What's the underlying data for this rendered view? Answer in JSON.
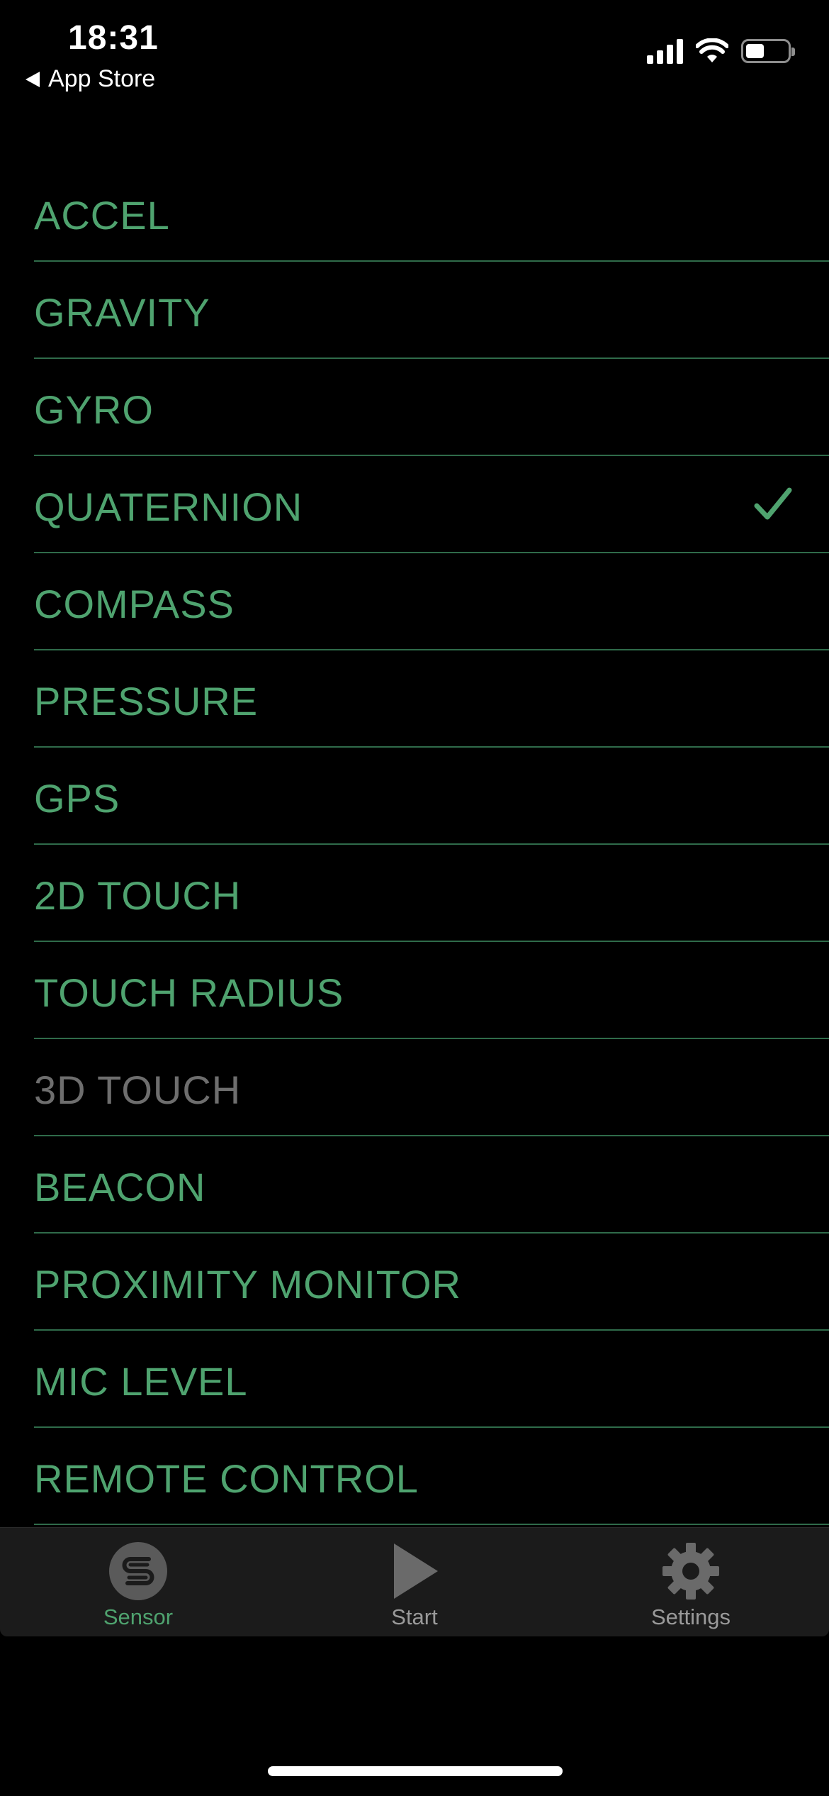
{
  "status_bar": {
    "time": "18:31",
    "back_label": "App Store",
    "battery_level": 0.45
  },
  "sensors": [
    {
      "label": "ACCEL",
      "selected": false,
      "enabled": true
    },
    {
      "label": "GRAVITY",
      "selected": false,
      "enabled": true
    },
    {
      "label": "GYRO",
      "selected": false,
      "enabled": true
    },
    {
      "label": "QUATERNION",
      "selected": true,
      "enabled": true
    },
    {
      "label": "COMPASS",
      "selected": false,
      "enabled": true
    },
    {
      "label": "PRESSURE",
      "selected": false,
      "enabled": true
    },
    {
      "label": "GPS",
      "selected": false,
      "enabled": true
    },
    {
      "label": "2D TOUCH",
      "selected": false,
      "enabled": true
    },
    {
      "label": "TOUCH RADIUS",
      "selected": false,
      "enabled": true
    },
    {
      "label": "3D TOUCH",
      "selected": false,
      "enabled": false
    },
    {
      "label": "BEACON",
      "selected": false,
      "enabled": true
    },
    {
      "label": "PROXIMITY MONITOR",
      "selected": false,
      "enabled": true
    },
    {
      "label": "MIC LEVEL",
      "selected": false,
      "enabled": true
    },
    {
      "label": "REMOTE CONTROL",
      "selected": false,
      "enabled": true
    }
  ],
  "tab_bar": {
    "tabs": [
      {
        "label": "Sensor",
        "icon": "sensor-icon",
        "active": true
      },
      {
        "label": "Start",
        "icon": "play-icon",
        "active": false
      },
      {
        "label": "Settings",
        "icon": "gear-icon",
        "active": false
      }
    ]
  },
  "colors": {
    "accent": "#4fa36f",
    "divider": "#2f6b4a",
    "disabled": "#6e6e6e",
    "background": "#000000",
    "tab_bar_background": "#1b1b1b"
  }
}
